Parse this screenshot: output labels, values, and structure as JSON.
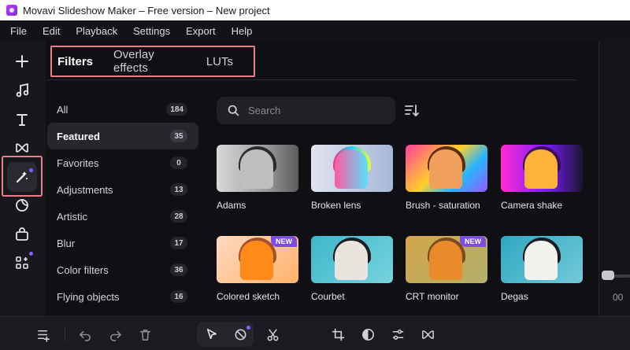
{
  "window": {
    "title": "Movavi Slideshow Maker – Free version – New project"
  },
  "menu": [
    "File",
    "Edit",
    "Playback",
    "Settings",
    "Export",
    "Help"
  ],
  "toolbar": [
    {
      "id": "add",
      "icon": "plus-icon"
    },
    {
      "id": "music",
      "icon": "music-note-icon"
    },
    {
      "id": "titles",
      "icon": "text-icon"
    },
    {
      "id": "transitions",
      "icon": "transition-bowtie-icon"
    },
    {
      "id": "filters",
      "icon": "magic-wand-icon",
      "active": true
    },
    {
      "id": "stickers",
      "icon": "sticker-icon"
    },
    {
      "id": "store",
      "icon": "store-bag-icon"
    },
    {
      "id": "more",
      "icon": "widgets-icon"
    }
  ],
  "tabs": [
    {
      "label": "Filters",
      "active": true
    },
    {
      "label": "Overlay effects",
      "active": false
    },
    {
      "label": "LUTs",
      "active": false
    }
  ],
  "categories": [
    {
      "label": "All",
      "count": "184"
    },
    {
      "label": "Featured",
      "count": "35",
      "active": true
    },
    {
      "label": "Favorites",
      "count": "0"
    },
    {
      "label": "Adjustments",
      "count": "13"
    },
    {
      "label": "Artistic",
      "count": "28"
    },
    {
      "label": "Blur",
      "count": "17"
    },
    {
      "label": "Color filters",
      "count": "36"
    },
    {
      "label": "Flying objects",
      "count": "16"
    }
  ],
  "search": {
    "placeholder": "Search",
    "value": ""
  },
  "filters": [
    {
      "name": "Adams",
      "badge": ""
    },
    {
      "name": "Broken lens",
      "badge": ""
    },
    {
      "name": "Brush - saturation",
      "badge": ""
    },
    {
      "name": "Camera shake",
      "badge": ""
    },
    {
      "name": "Colored sketch",
      "badge": "NEW"
    },
    {
      "name": "Courbet",
      "badge": ""
    },
    {
      "name": "CRT monitor",
      "badge": "NEW"
    },
    {
      "name": "Degas",
      "badge": ""
    }
  ],
  "player": {
    "time_readout": "00"
  },
  "colors": {
    "accent": "#7b4ee0",
    "highlight": "#e8808c"
  }
}
